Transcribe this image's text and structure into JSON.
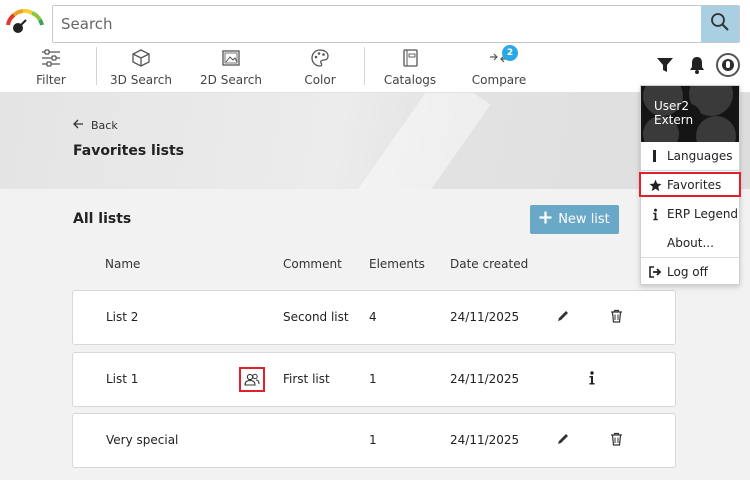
{
  "search": {
    "placeholder": "Search"
  },
  "toolbar": {
    "items": [
      {
        "label": "Filter",
        "icon": "sliders-icon"
      },
      {
        "label": "3D Search",
        "icon": "cube-icon"
      },
      {
        "label": "2D Search",
        "icon": "image-icon"
      },
      {
        "label": "Color",
        "icon": "palette-icon"
      },
      {
        "label": "Catalogs",
        "icon": "catalog-icon"
      },
      {
        "label": "Compare",
        "icon": "compare-icon",
        "badge": "2"
      }
    ]
  },
  "header_icons": [
    "filter-icon",
    "bell-icon",
    "avatar-icon"
  ],
  "banner": {
    "back_label": "Back",
    "title": "Favorites lists"
  },
  "lists": {
    "title": "All lists",
    "new_button": "New list",
    "columns": [
      "Name",
      "Comment",
      "Elements",
      "Date created"
    ],
    "rows": [
      {
        "name": "List 2",
        "comment": "Second list",
        "elements": "4",
        "date": "24/11/2025",
        "actions": [
          "edit",
          "delete"
        ]
      },
      {
        "name": "List 1",
        "comment": "First list",
        "elements": "1",
        "date": "24/11/2025",
        "shared": true,
        "actions": [
          "info"
        ]
      },
      {
        "name": "Very special",
        "comment": "",
        "elements": "1",
        "date": "24/11/2025",
        "actions": [
          "edit",
          "delete"
        ]
      }
    ]
  },
  "user_menu": {
    "user_line1": "User2",
    "user_line2": "Extern",
    "items": [
      {
        "label": "Languages",
        "icon": "language-icon"
      },
      {
        "label": "Favorites",
        "icon": "star-icon",
        "highlighted": true
      },
      {
        "label": "ERP Legend",
        "icon": "info-icon"
      },
      {
        "label": "About...",
        "icon": ""
      },
      {
        "label": "Log off",
        "icon": "logout-icon"
      }
    ]
  },
  "colors": {
    "accent": "#6aa8c8",
    "search_button": "#a9cfe3",
    "badge": "#2aa8e6",
    "highlight": "#e0202a"
  }
}
